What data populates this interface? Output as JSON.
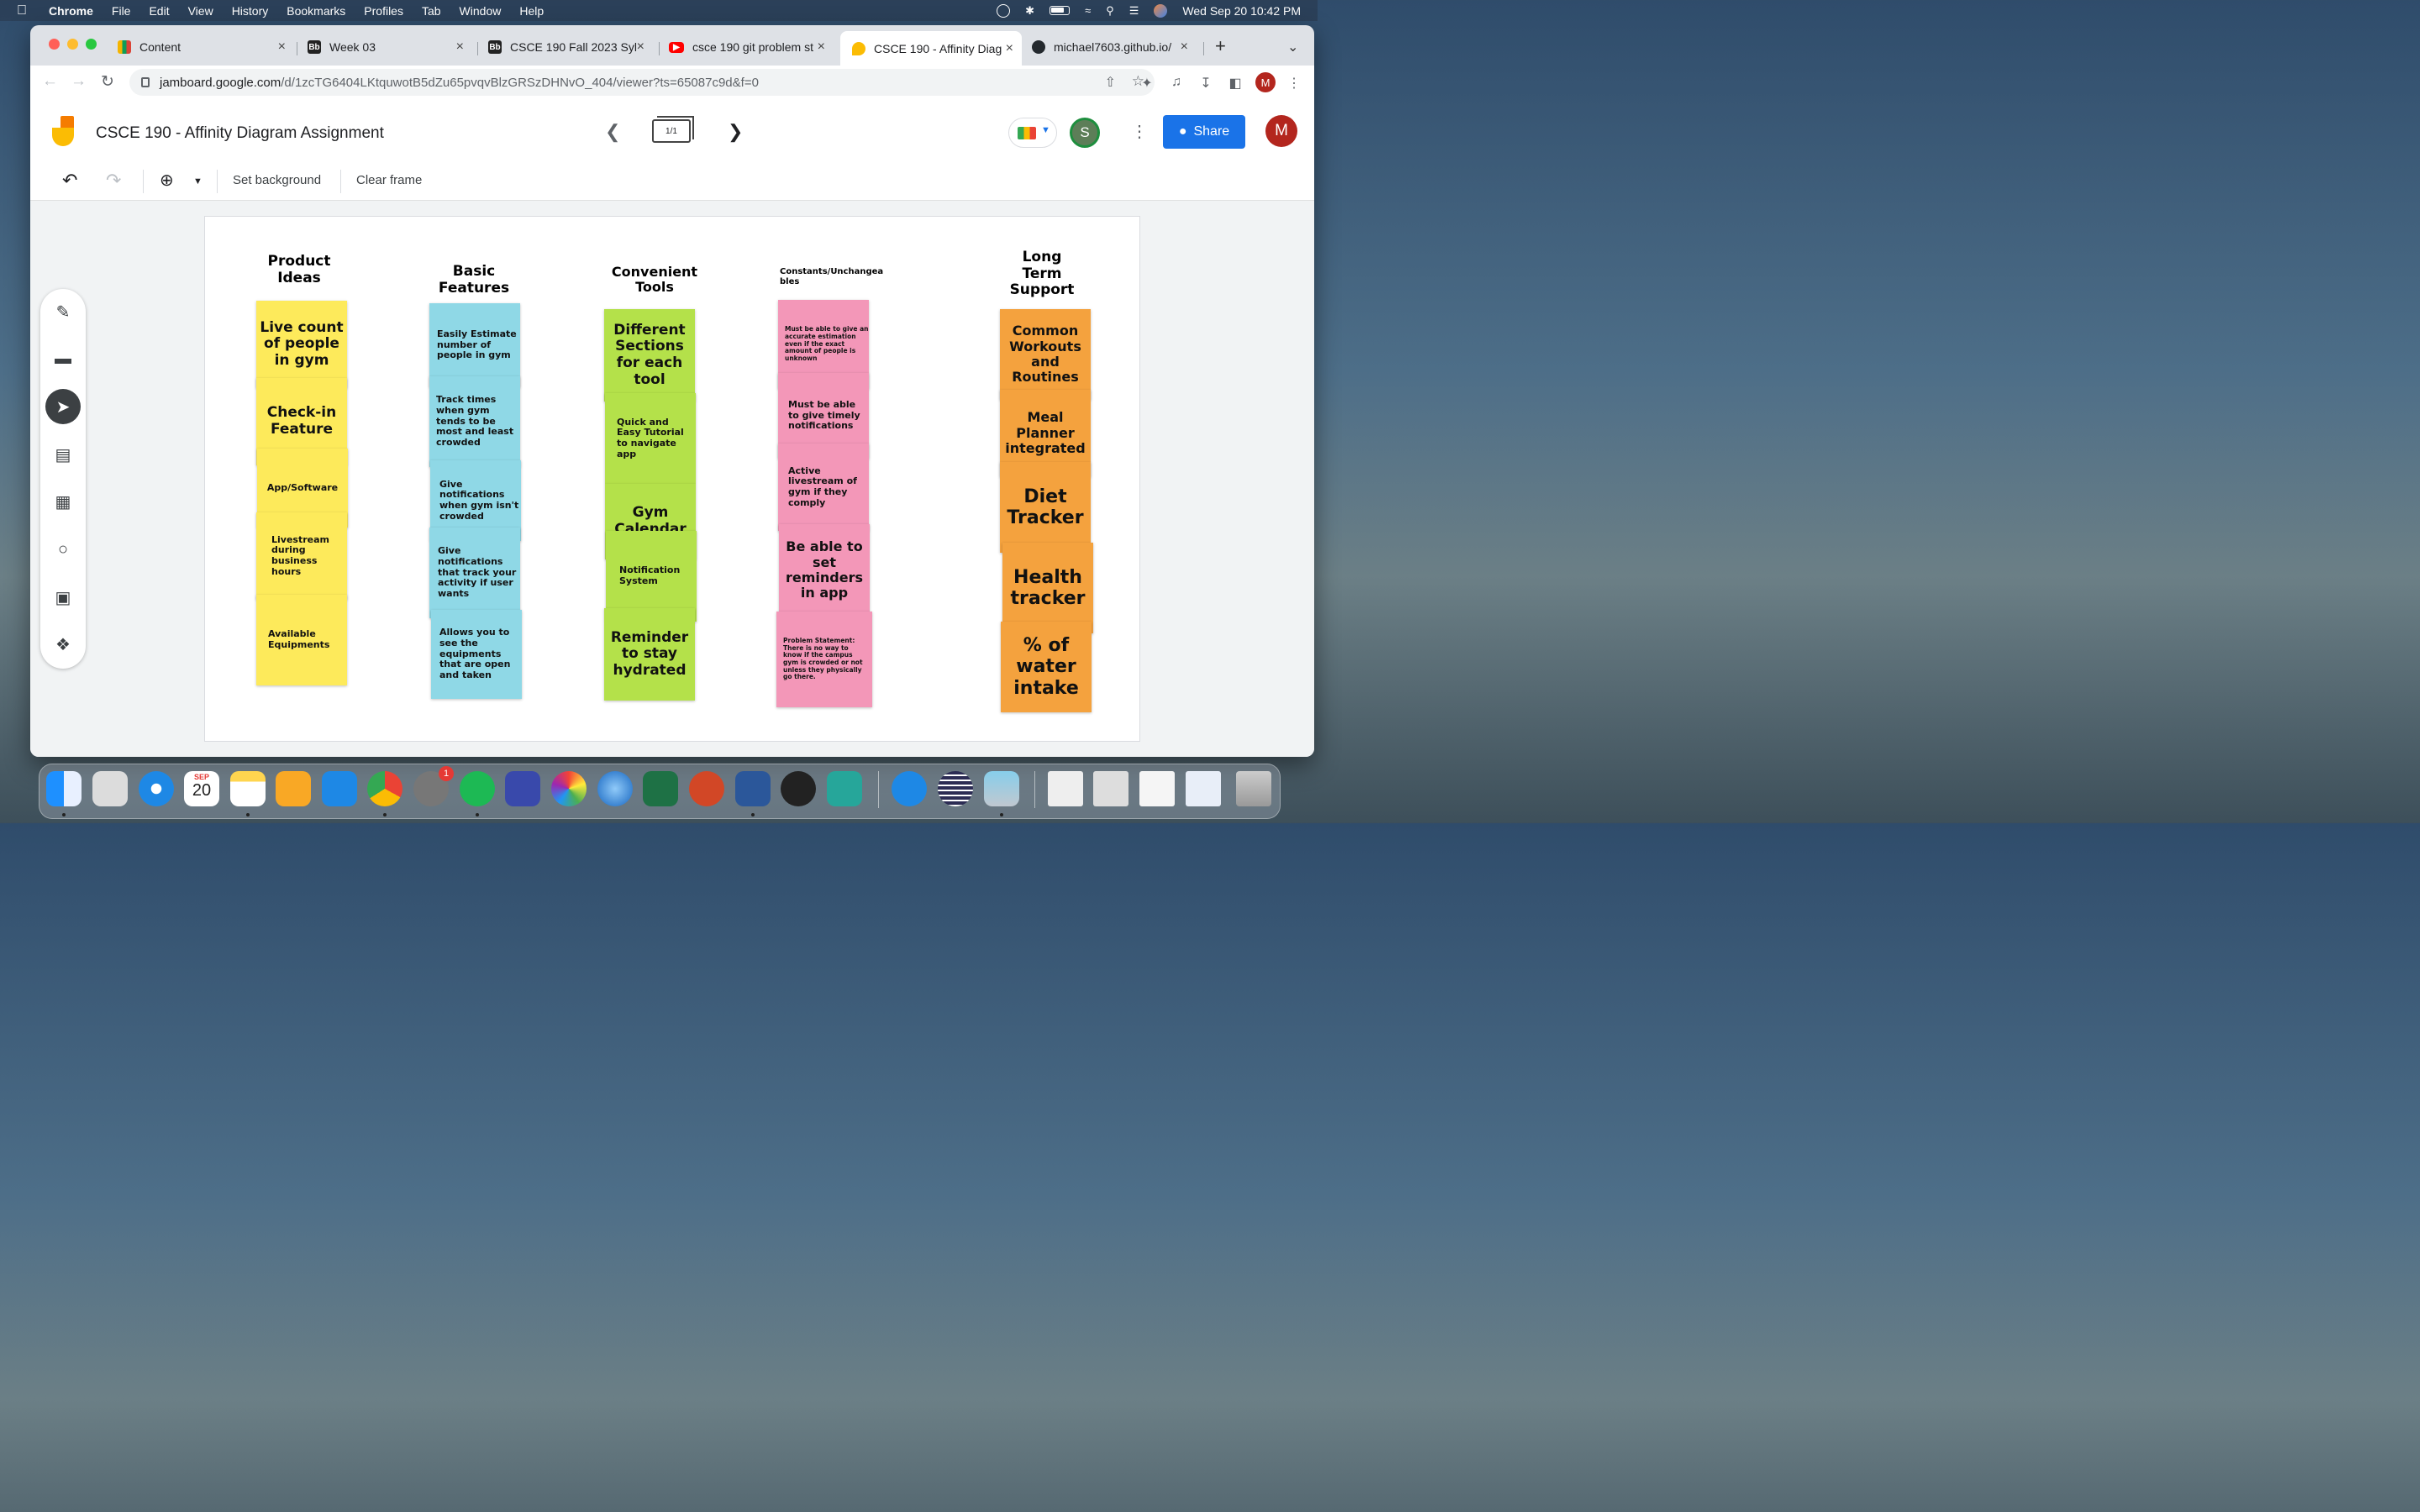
{
  "menubar": {
    "app": "Chrome",
    "items": [
      "File",
      "Edit",
      "View",
      "History",
      "Bookmarks",
      "Profiles",
      "Tab",
      "Window",
      "Help"
    ],
    "clock": "Wed Sep 20  10:42 PM"
  },
  "tabs": [
    {
      "title": "Content",
      "icon": "content-favicon",
      "color": "#202124"
    },
    {
      "title": "Week 03",
      "icon": "blackboard-favicon",
      "color": "#222222"
    },
    {
      "title": "CSCE 190 Fall 2023 Syl",
      "icon": "blackboard-favicon",
      "color": "#222222"
    },
    {
      "title": "csce 190 git problem st",
      "icon": "youtube-favicon",
      "color": "#ff0000"
    },
    {
      "title": "CSCE 190 - Affinity Diag",
      "icon": "jamboard-favicon",
      "color": "#fbbc04"
    },
    {
      "title": "michael7603.github.io/",
      "icon": "github-favicon",
      "color": "#24292e"
    }
  ],
  "address": {
    "host": "jamboard.google.com",
    "path": "/d/1zcTG6404LKtquwotB5dZu65pvqvBlzGRSzDHNvO_404/viewer?ts=65087c9d&f=0"
  },
  "browser": {
    "profile_initial": "M"
  },
  "app": {
    "title": "CSCE 190 - Affinity Diagram Assignment",
    "frame_indicator": "1/1",
    "collaborator_initial": "S",
    "share_label": "Share",
    "user_initial": "M"
  },
  "toolbar": {
    "set_background": "Set background",
    "clear_frame": "Clear frame"
  },
  "columns": [
    {
      "title": "Product Ideas",
      "color": "#fdea5b",
      "notes": [
        "Live count of people in gym",
        "Check-in Feature",
        "App/Software",
        "Livestream during business hours",
        "Available Equipments"
      ]
    },
    {
      "title": "Basic Features",
      "color": "#8fd8e6",
      "notes": [
        "Easily Estimate number of people in gym",
        "Track times when gym tends to be most and least crowded",
        "Give notifications when gym isn't crowded",
        "Give notifications that track your activity if user wants",
        "Allows you to see the equipments that are open and taken"
      ]
    },
    {
      "title": "Convenient Tools",
      "color": "#b4e14a",
      "notes": [
        "Different Sections for each tool",
        "Quick and Easy Tutorial to navigate app",
        "Gym Calendar",
        "Notification System",
        "Reminder to stay hydrated"
      ]
    },
    {
      "title": "Constants/Unchangeables",
      "color": "#f397b8",
      "notes": [
        "Must be able to give an accurate estimation even if the exact amount of people is unknown",
        "Must be able to give timely notifications",
        "Active livestream of gym if they comply",
        "Be able to set reminders in app",
        "Problem Statement: There is no way to know if the campus gym is crowded or not unless they physically go there."
      ]
    },
    {
      "title": "Long Term Support",
      "color": "#f4a23e",
      "notes": [
        "Common Workouts and Routines",
        "Meal Planner integrated",
        "Diet Tracker",
        "Health tracker",
        "% of water intake"
      ]
    }
  ],
  "dock": {
    "calendar_month": "SEP",
    "calendar_day": "20",
    "settings_badge": "1"
  }
}
